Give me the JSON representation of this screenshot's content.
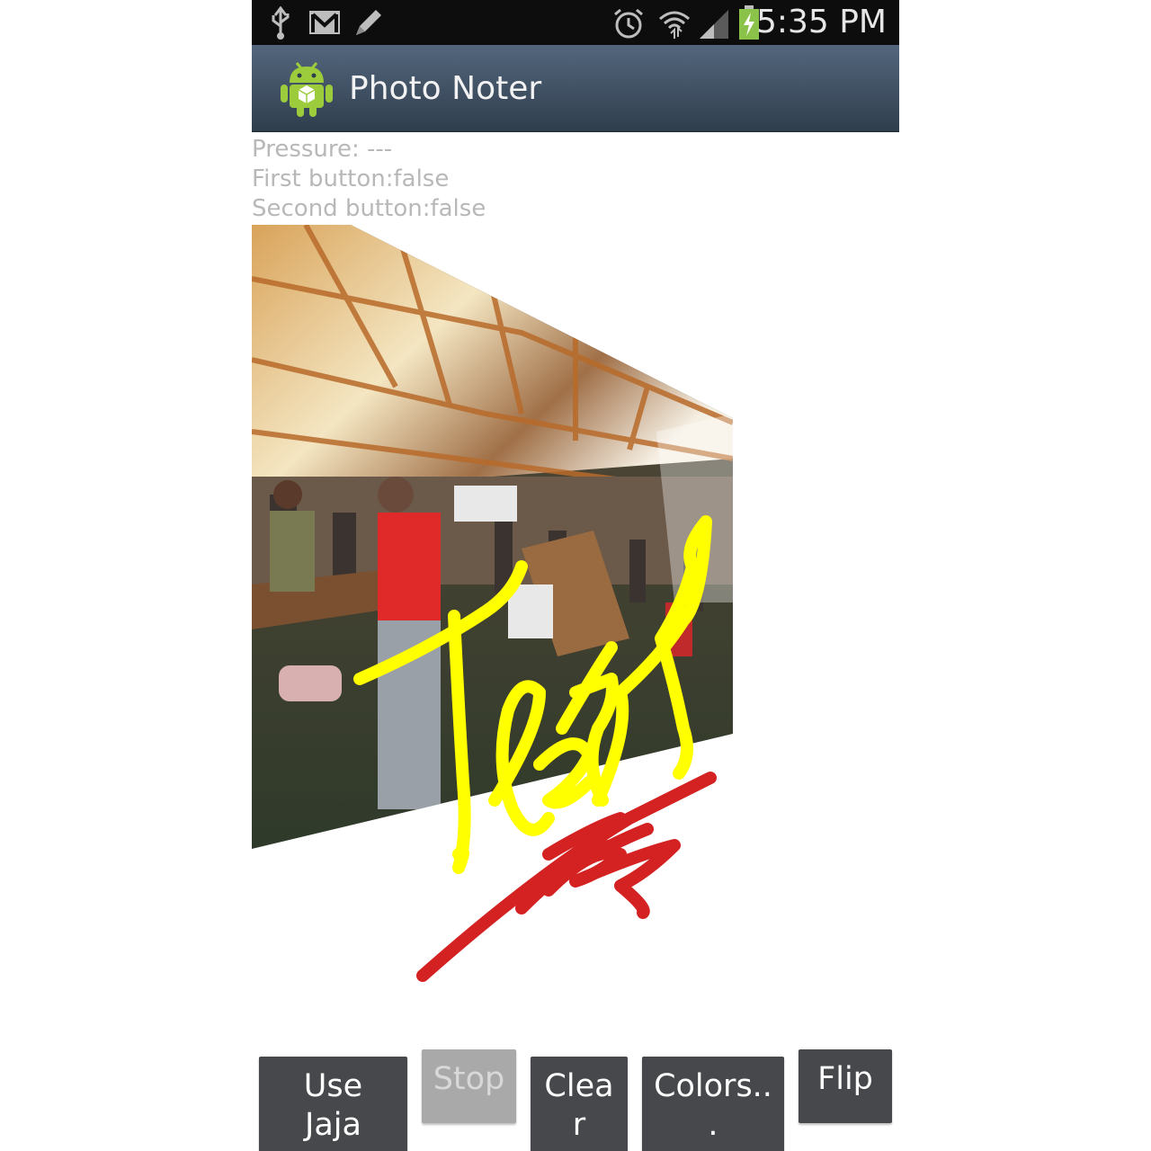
{
  "status_bar": {
    "time": "5:35 PM",
    "icons": [
      "usb-icon",
      "gmail-icon",
      "edit-pencil-icon",
      "alarm-clock-icon",
      "wifi-icon",
      "cell-signal-icon",
      "battery-charging-icon"
    ],
    "background": "#0d0d0d"
  },
  "action_bar": {
    "title": "Photo Noter",
    "app_icon": "android-robot-icon",
    "gradient": [
      "#54667d",
      "#2f3e4d"
    ]
  },
  "info": {
    "pressure": "Pressure: ---",
    "first_button": "First button:false",
    "second_button": "Second button:false"
  },
  "canvas": {
    "photo": "photo-of-crowded-hall",
    "annotation_text": "Test",
    "stroke_colors": {
      "yellow": "#ffff00",
      "red": "#d42222"
    }
  },
  "buttons": {
    "use_jaja_line1": "Use",
    "use_jaja_line2": "Jaja",
    "stop": "Stop",
    "clear_line1": "Clea",
    "clear_line2": "r",
    "colors_line1": "Colors..",
    "colors_line2": ".",
    "flip": "Flip"
  }
}
